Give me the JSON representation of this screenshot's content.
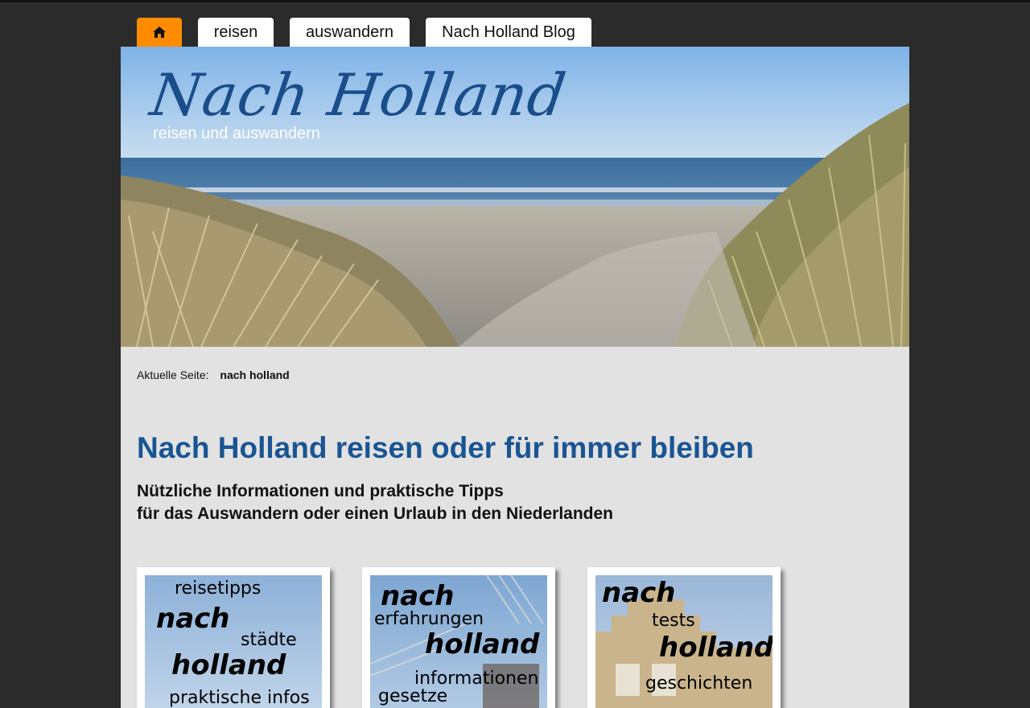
{
  "nav": {
    "home_icon": "home-icon",
    "tabs": [
      {
        "label": "reisen"
      },
      {
        "label": "auswandern"
      },
      {
        "label": "Nach Holland Blog"
      }
    ]
  },
  "header": {
    "logo_title": "Nach Holland",
    "logo_subtitle": "reisen und auswandern"
  },
  "breadcrumb": {
    "prefix": "Aktuelle Seite:",
    "current": "nach holland"
  },
  "main": {
    "title": "Nach Holland reisen oder für immer bleiben",
    "subtitle_line1": "Nützliche Informationen und praktische Tipps",
    "subtitle_line2": "für das Auswandern oder einen Urlaub in den Niederlanden"
  },
  "cards": [
    {
      "words": [
        "reisetipps",
        "nach",
        "städte",
        "holland",
        "praktische infos"
      ]
    },
    {
      "words": [
        "nach",
        "erfahrungen",
        "holland",
        "informationen",
        "gesetze"
      ]
    },
    {
      "words": [
        "nach",
        "tests",
        "holland",
        "geschichten"
      ]
    }
  ],
  "colors": {
    "accent": "#ff8c00",
    "title_blue": "#1a5593",
    "background": "#2b2b2b",
    "content_bg": "#e2e2e2"
  }
}
